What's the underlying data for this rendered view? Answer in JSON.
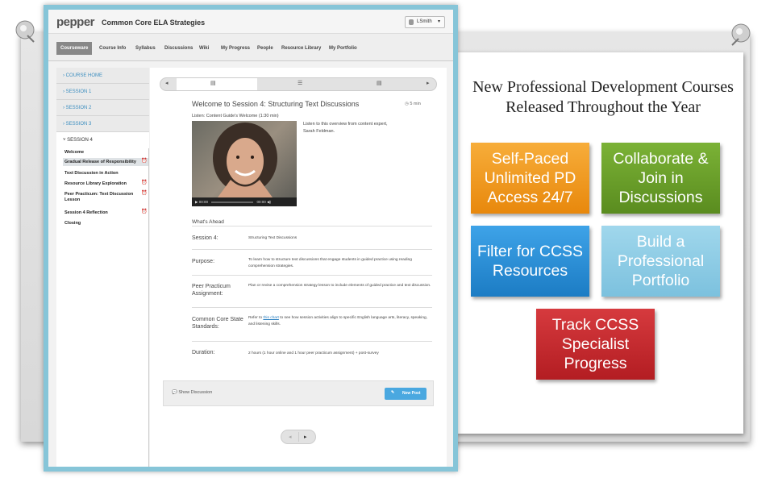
{
  "app": {
    "logo": "pepper",
    "title": "Common Core ELA Strategies",
    "user": "LSmith"
  },
  "nav": {
    "tabs": [
      "Courseware",
      "Course Info",
      "Syllabus",
      "Discussions",
      "Wiki",
      "My Progress",
      "People",
      "Resource Library",
      "My Portfolio"
    ]
  },
  "sidebar": {
    "items": [
      "COURSE HOME",
      "SESSION 1",
      "SESSION 2",
      "SESSION 3",
      "SESSION 4"
    ],
    "subitems": [
      "Welcome",
      "Gradual Release of Responsibility",
      "Text Discussion in Action",
      "Resource Library Exploration",
      "Peer Practicum: Text Discussion Lesson",
      "Session 4 Reflection",
      "Closing"
    ]
  },
  "lesson": {
    "title": "Welcome to Session 4: Structuring Text Discussions",
    "duration": "5 min",
    "listen_label": "Listen: Content Guide's Welcome (1:30 min)",
    "video_desc": "Listen to this overview from content expert, Sarah Feldman.",
    "video_time_start": "00:00",
    "video_time_end": "00:00",
    "whats_ahead": "What's Ahead",
    "rows": [
      {
        "label": "Session 4:",
        "value": "Structuring Text Discussions"
      },
      {
        "label": "Purpose:",
        "value": "To learn how to structure text discussions that engage students in guided practice using reading comprehension strategies."
      },
      {
        "label": "Peer Practicum Assignment:",
        "value": "Plan or revise a comprehension strategy lesson to include elements of guided practice and text discussion."
      },
      {
        "label": "Common Core State Standards:",
        "value_pre": "Refer to ",
        "value_link": "this chart",
        "value_post": " to see how session activities align to specific English language arts, literacy, speaking, and listening skills."
      },
      {
        "label": "Duration:",
        "value": "2 hours (1 hour online and 1 hour peer practicum assignment) + post-survey"
      }
    ],
    "show_discussion": "Show Discussion",
    "new_post": "New Post"
  },
  "promo": {
    "title": "New Professional Development Courses Released Throughout the Year",
    "tiles": [
      {
        "text": "Self-Paced Unlimited PD Access 24/7",
        "color": "#f49b1c"
      },
      {
        "text": "Collaborate & Join in Discussions",
        "color": "#6a9e2a"
      },
      {
        "text": "Filter for CCSS Resources",
        "color": "#2a8fd6"
      },
      {
        "text": "Build a Professional Portfolio",
        "color": "#8ecde6"
      },
      {
        "text": "Track CCSS Specialist Progress",
        "color": "#c9262b"
      }
    ]
  }
}
